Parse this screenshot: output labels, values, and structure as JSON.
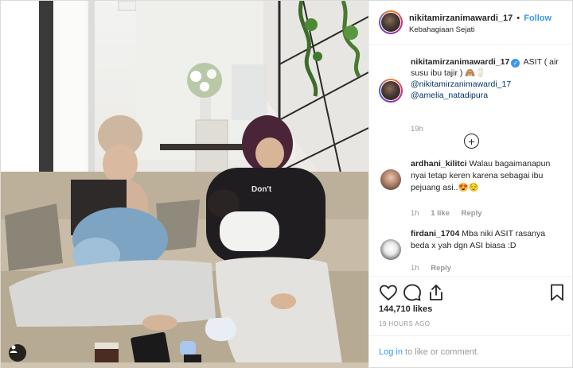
{
  "post": {
    "username": "nikitamirzanimawardi_17",
    "username_truncated": "nikitamirzanimawardi_17",
    "dot": "•",
    "follow_label": "Follow",
    "location": "Kebahagiaan Sejati",
    "more_label": "···"
  },
  "caption": {
    "username": "nikitamirzanimawardi_17",
    "verified_mark": "✓",
    "text": "ASIT ( air susu ibu tajir ) 🙈🥛",
    "mention_1": "@nikitamirzanimawardi_17",
    "mention_2": "@amelia_natadipura",
    "time": "19h"
  },
  "load_more_icon": "plus-circle-icon",
  "load_more_label": "+",
  "comments": [
    {
      "username": "ardhani_kilitci",
      "text": "Walau bagaimanapun nyai tetap keren karena sebagai ibu pejuang asi..😍😌",
      "time": "1h",
      "likes": "1 like",
      "reply": "Reply"
    },
    {
      "username": "firdani_1704",
      "text": "Mba niki ASIT rasanya beda x yah dgn ASI biasa :D",
      "time": "1h",
      "reply": "Reply"
    }
  ],
  "actions": {
    "icons": [
      "heart-icon",
      "comment-icon",
      "share-icon",
      "bookmark-icon"
    ],
    "like_count": "144,710 likes",
    "timestamp": "19 HOURS AGO"
  },
  "login": {
    "link": "Log in",
    "suffix": " to like or comment.",
    "more_label": "···"
  },
  "colors": {
    "accent": "#3897f0",
    "mention": "#003569",
    "muted": "#999999",
    "text": "#262626",
    "border": "#efefef"
  }
}
